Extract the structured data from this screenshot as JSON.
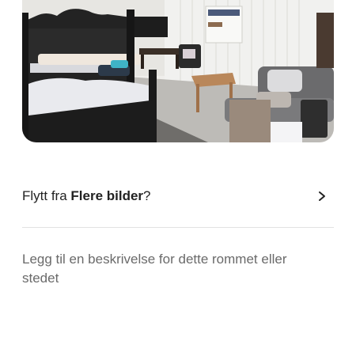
{
  "photo": {
    "icon": "room-photo"
  },
  "move_row": {
    "prefix": "Flytt fra ",
    "album": "Flere bilder",
    "suffix": "?",
    "icon": "chevron-right-icon"
  },
  "description": {
    "label": "Legg til en beskrivelse for dette rommet eller stedet"
  }
}
